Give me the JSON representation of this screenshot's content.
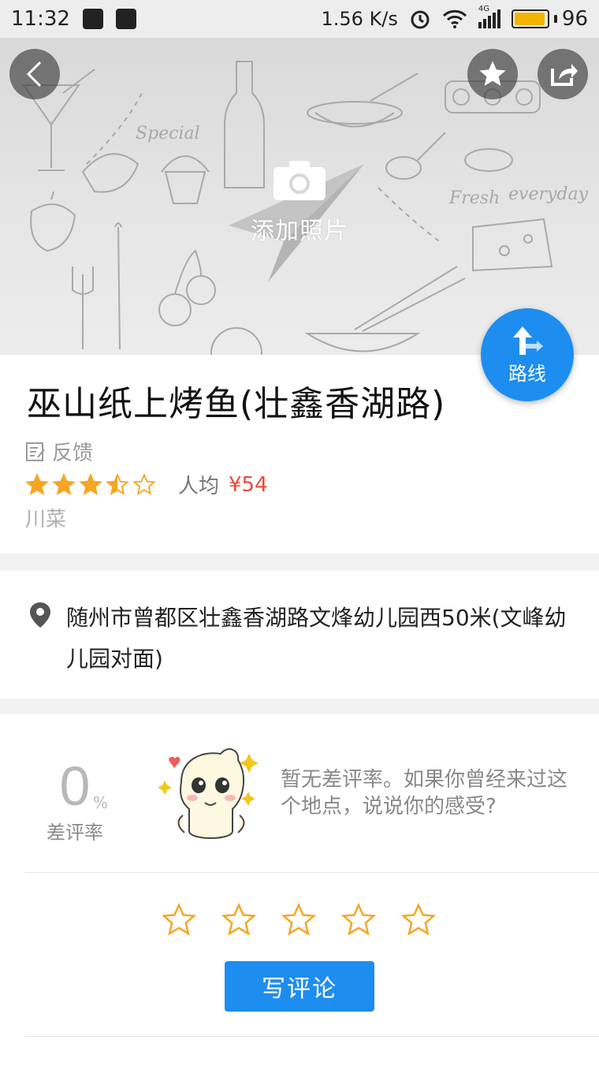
{
  "status_bar": {
    "time": "11:32",
    "speed": "1.56 K/s",
    "network": "4G",
    "battery": "96",
    "battery_level": 0.96
  },
  "hero": {
    "add_photo_label": "添加照片",
    "back_icon": "chevron-left-icon",
    "favorite_icon": "star-icon",
    "share_icon": "share-icon",
    "camera_icon": "camera-icon"
  },
  "route": {
    "label": "路线",
    "icon": "route-arrow-icon"
  },
  "place": {
    "title": "巫山纸上烤鱼(壮鑫香湖路)",
    "feedback_label": "反馈",
    "rating": 3.5,
    "rating_max": 5,
    "avg_label": "人均",
    "avg_price": "¥54",
    "category": "川菜"
  },
  "address": {
    "text": "随州市曾都区壮鑫香湖路文烽幼儿园西50米(文峰幼儿园对面)",
    "icon": "location-pin-icon"
  },
  "review": {
    "bad_rate_value": "0",
    "bad_rate_unit": "%",
    "bad_rate_label": "差评率",
    "empty_message": "暂无差评率。如果你曾经来过这个地点，说说你的感受?",
    "write_button": "写评论"
  },
  "colors": {
    "accent": "#1e8df0",
    "price": "#e64a3b",
    "star": "#f5a623",
    "status_bg": "#ededed"
  }
}
